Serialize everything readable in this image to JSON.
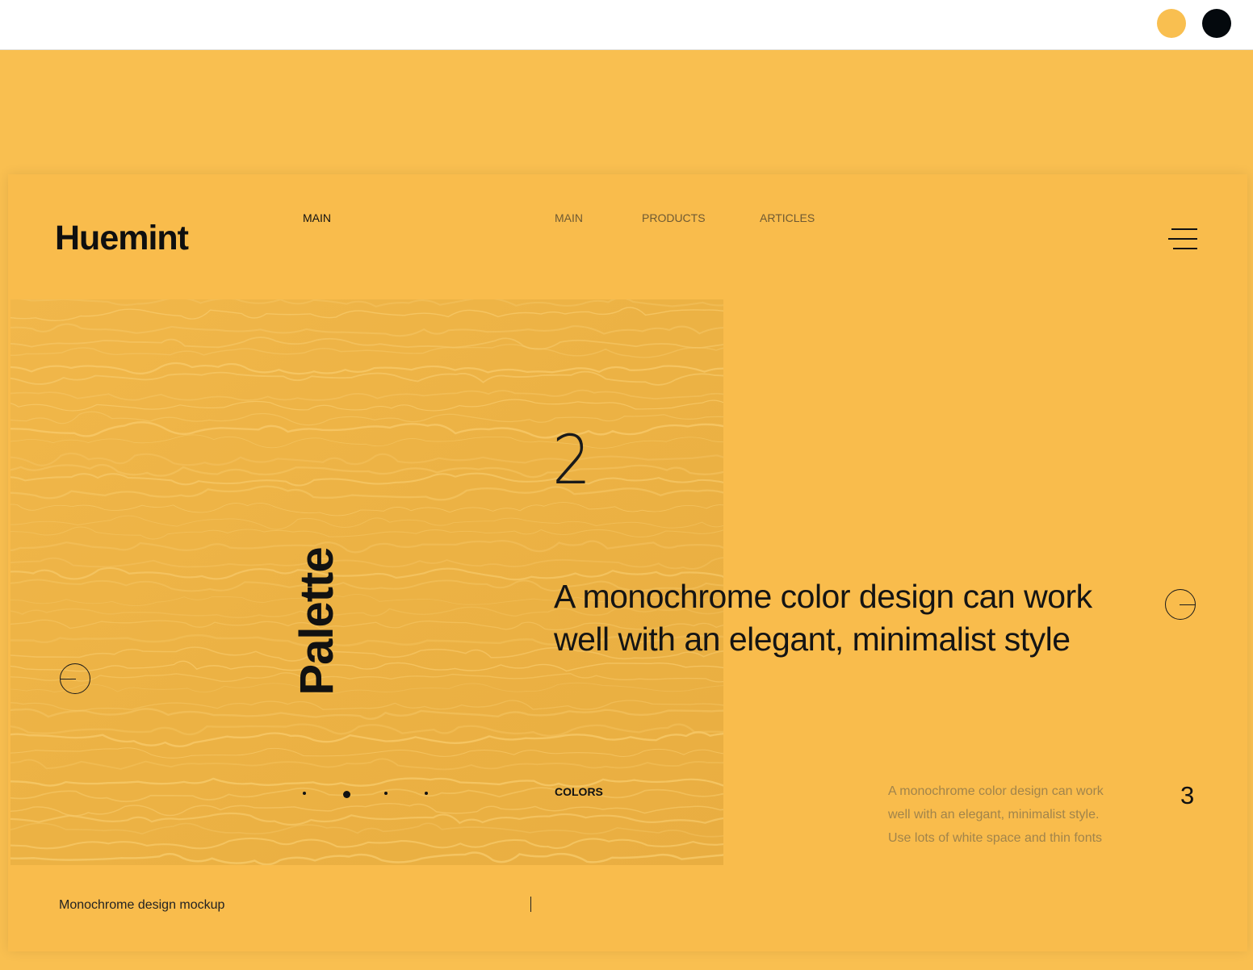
{
  "theme": {
    "background": "#f9bf50",
    "text": "#111111",
    "muted_text": "#a1844b"
  },
  "color_swatches": [
    {
      "name": "yellow",
      "hex": "#f9bf50"
    },
    {
      "name": "black",
      "hex": "#04090d"
    }
  ],
  "header": {
    "logo": "Huemint",
    "current_label": "MAIN",
    "nav": [
      "MAIN",
      "PRODUCTS",
      "ARTICLES"
    ],
    "menu_icon": "hamburger-menu-icon"
  },
  "hero": {
    "vertical_title": "Palette",
    "slide_number": "2",
    "headline": "A monochrome color design can work well with an elegant, minimalist style",
    "prev_icon": "arrow-left-circle-icon",
    "next_icon": "arrow-right-circle-icon",
    "slide_dots": {
      "count": 4,
      "active_index": 1
    }
  },
  "footer": {
    "section_label": "COLORS",
    "description": "A monochrome color design can work well with an elegant, minimalist style. Use lots of white space and thin fonts",
    "next_number": "3",
    "caption": "Monochrome design mockup"
  }
}
